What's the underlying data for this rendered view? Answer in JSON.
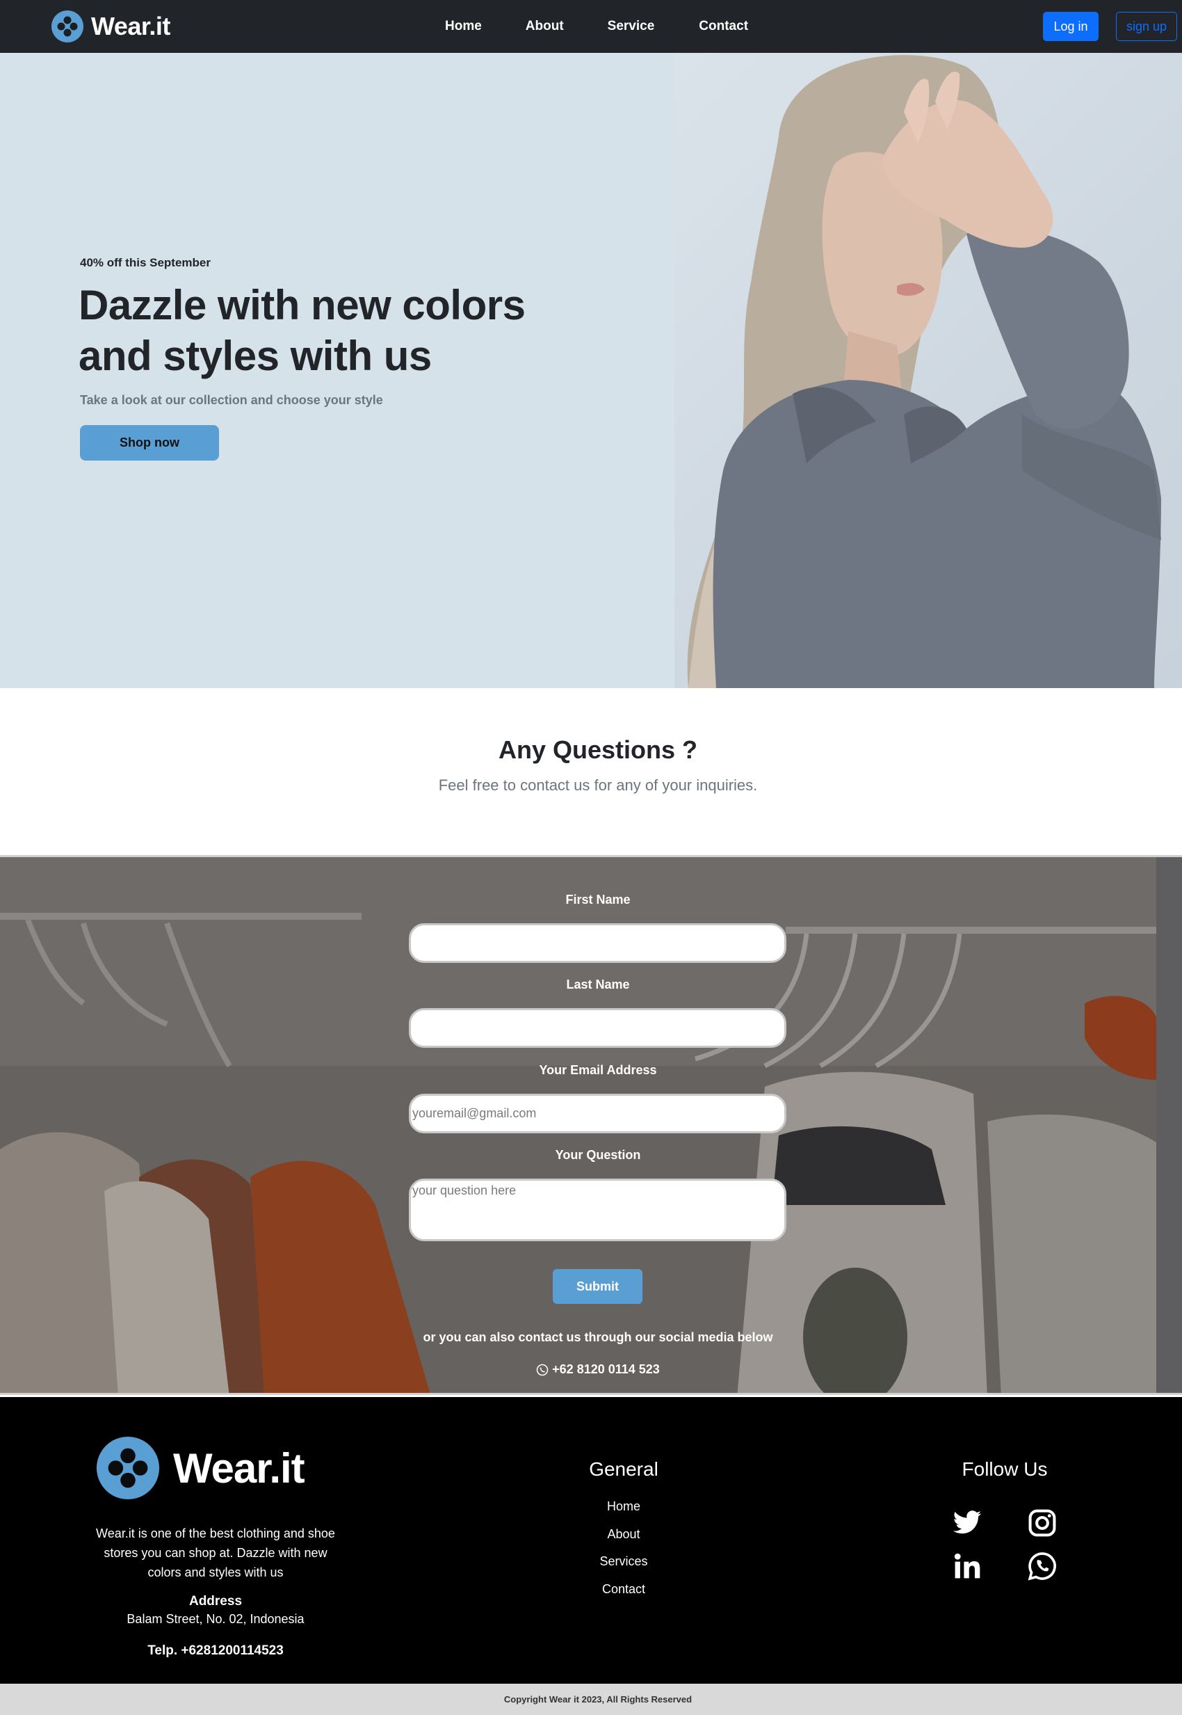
{
  "nav": {
    "brand": "Wear.it",
    "links": [
      "Home",
      "About",
      "Service",
      "Contact"
    ],
    "login_label": "Log in",
    "signup_label": "sign up"
  },
  "hero": {
    "promo": "40% off this September",
    "title": "Dazzle with new colors and styles with us",
    "subtitle": "Take a look at our collection and choose your style",
    "cta_label": "Shop now"
  },
  "questions": {
    "title": "Any Questions ?",
    "subtitle": "Feel free to contact us for any of your inquiries."
  },
  "form": {
    "first_name_label": "First Name",
    "first_name_value": "",
    "last_name_label": "Last Name",
    "last_name_value": "",
    "email_label": "Your Email Address",
    "email_placeholder": "youremail@gmail.com",
    "question_label": "Your Question",
    "question_placeholder": "your question here",
    "submit_label": "Submit",
    "social_note": "or you can also contact us through our social media below",
    "phone": "+62 8120 0114 523"
  },
  "footer": {
    "brand": "Wear.it",
    "description": "Wear.it is one of the best clothing and shoe stores you can shop at. Dazzle with new colors and styles with us",
    "address_heading": "Address",
    "address": "Balam Street, No. 02, Indonesia",
    "telp": "Telp. +6281200114523",
    "general_heading": "General",
    "general_links": [
      "Home",
      "About",
      "Services",
      "Contact"
    ],
    "follow_heading": "Follow Us",
    "social_icons": [
      "twitter-icon",
      "instagram-icon",
      "linkedin-icon",
      "whatsapp-icon"
    ]
  },
  "copyright": "Copyright Wear it 2023, All Rights Reserved",
  "colors": {
    "navbar_bg": "#212529",
    "hero_bg": "#d6e2ea",
    "accent_blue": "#5a9fd4",
    "primary": "#0d6efd",
    "footer_bg": "#000000",
    "copyright_bg": "#d9d9d9"
  }
}
